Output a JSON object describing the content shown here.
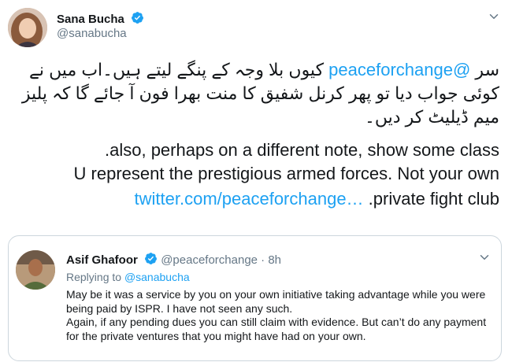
{
  "author": {
    "name": "Sana Bucha",
    "handle": "@sanabucha"
  },
  "tweet": {
    "rtl_pre": "سر ",
    "mention": "@peaceforchange",
    "rtl_post": " کیوں بلا وجہ کے پنگے لیتے ہیں۔اب میں نے کوئی جواب دیا تو پھر کرنل شفیق کا منت بھرا فون آ جائے گا کہ پلیز میم ڈیلیٹ کر دیں۔",
    "line4": ".also, perhaps on a different note, show some class",
    "line5": "U represent the prestigious armed forces. Not your own",
    "link": "twitter.com/peaceforchange…",
    "line6_tail": " .private fight club"
  },
  "quoted": {
    "name": "Asif Ghafoor",
    "handle": "@peaceforchange",
    "time": "· 8h",
    "replying_prefix": "Replying to ",
    "replying_handle": "@sanabucha",
    "paragraph1": "May be it was a service by you on your own initiative taking advantage while you were being paid by ISPR. I have not seen any such.",
    "paragraph2": "Again, if any pending dues you can still claim with evidence. But can’t do any payment for the private ventures that you might have had on your own."
  },
  "icons": {
    "verified": "verified-badge-icon",
    "caret": "chevron-down-icon"
  },
  "colors": {
    "accent": "#1da1f2",
    "secondary_text": "#657786",
    "border": "#ccd6dd"
  }
}
